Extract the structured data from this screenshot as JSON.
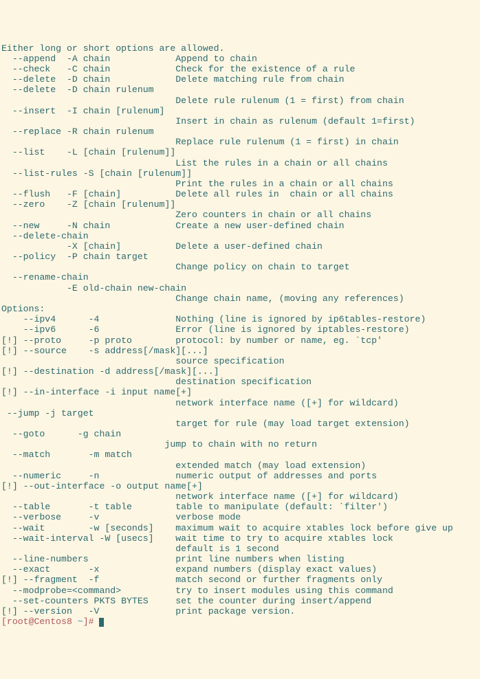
{
  "header": "Either long or short options are allowed.",
  "commands": [
    {
      "long": "  --append  -A chain",
      "desc": "            Append to chain"
    },
    {
      "long": "  --check   -C chain",
      "desc": "            Check for the existence of a rule"
    },
    {
      "long": "  --delete  -D chain",
      "desc": "            Delete matching rule from chain"
    },
    {
      "long": "  --delete  -D chain rulenum",
      "desc": ""
    },
    {
      "long": "",
      "desc": "                                Delete rule rulenum (1 = first) from chain"
    },
    {
      "long": "  --insert  -I chain [rulenum]",
      "desc": ""
    },
    {
      "long": "",
      "desc": "                                Insert in chain as rulenum (default 1=first)"
    },
    {
      "long": "  --replace -R chain rulenum",
      "desc": ""
    },
    {
      "long": "",
      "desc": "                                Replace rule rulenum (1 = first) in chain"
    },
    {
      "long": "  --list    -L [chain [rulenum]]",
      "desc": ""
    },
    {
      "long": "",
      "desc": "                                List the rules in a chain or all chains"
    },
    {
      "long": "  --list-rules -S [chain [rulenum]]",
      "desc": ""
    },
    {
      "long": "",
      "desc": "                                Print the rules in a chain or all chains"
    },
    {
      "long": "  --flush   -F [chain]",
      "desc": "          Delete all rules in  chain or all chains"
    },
    {
      "long": "  --zero    -Z [chain [rulenum]]",
      "desc": ""
    },
    {
      "long": "",
      "desc": "                                Zero counters in chain or all chains"
    },
    {
      "long": "  --new     -N chain",
      "desc": "            Create a new user-defined chain"
    },
    {
      "long": "  --delete-chain",
      "desc": ""
    },
    {
      "long": "            -X [chain]",
      "desc": "          Delete a user-defined chain"
    },
    {
      "long": "  --policy  -P chain target",
      "desc": ""
    },
    {
      "long": "",
      "desc": "                                Change policy on chain to target"
    },
    {
      "long": "  --rename-chain",
      "desc": ""
    },
    {
      "long": "            -E old-chain new-chain",
      "desc": ""
    },
    {
      "long": "",
      "desc": "                                Change chain name, (moving any references)"
    }
  ],
  "options_header": "Options:",
  "options": [
    {
      "o": "    --ipv4      -4",
      "d": "              Nothing (line is ignored by ip6tables-restore)"
    },
    {
      "o": "    --ipv6      -6",
      "d": "              Error (line is ignored by iptables-restore)"
    },
    {
      "o": "[!] --proto     -p proto",
      "d": "        protocol: by number or name, eg. `tcp'"
    },
    {
      "o": "[!] --source    -s address[/mask][...]",
      "d": ""
    },
    {
      "o": "",
      "d": "                                source specification"
    },
    {
      "o": "[!] --destination -d address[/mask][...]",
      "d": ""
    },
    {
      "o": "",
      "d": "                                destination specification"
    },
    {
      "o": "[!] --in-interface -i input name[+]",
      "d": ""
    },
    {
      "o": "",
      "d": "                                network interface name ([+] for wildcard)"
    },
    {
      "o": " --jump -j target",
      "d": ""
    },
    {
      "o": "",
      "d": "                                target for rule (may load target extension)"
    },
    {
      "o": "  --goto      -g chain",
      "d": ""
    },
    {
      "o": "",
      "d": "                              jump to chain with no return"
    },
    {
      "o": "  --match       -m match",
      "d": ""
    },
    {
      "o": "",
      "d": "                                extended match (may load extension)"
    },
    {
      "o": "  --numeric     -n",
      "d": "              numeric output of addresses and ports"
    },
    {
      "o": "[!] --out-interface -o output name[+]",
      "d": ""
    },
    {
      "o": "",
      "d": "                                network interface name ([+] for wildcard)"
    },
    {
      "o": "  --table       -t table",
      "d": "        table to manipulate (default: `filter')"
    },
    {
      "o": "  --verbose     -v",
      "d": "              verbose mode"
    },
    {
      "o": "  --wait        -w [seconds]",
      "d": "    maximum wait to acquire xtables lock before give up"
    },
    {
      "o": "  --wait-interval -W [usecs]",
      "d": "    wait time to try to acquire xtables lock"
    },
    {
      "o": "",
      "d": "                                default is 1 second"
    },
    {
      "o": "  --line-numbers",
      "d": "                print line numbers when listing"
    },
    {
      "o": "  --exact       -x",
      "d": "              expand numbers (display exact values)"
    },
    {
      "o": "[!] --fragment  -f",
      "d": "              match second or further fragments only"
    },
    {
      "o": "  --modprobe=<command>",
      "d": "          try to insert modules using this command"
    },
    {
      "o": "  --set-counters PKTS BYTES",
      "d": "     set the counter during insert/append"
    },
    {
      "o": "[!] --version   -V",
      "d": "              print package version."
    }
  ],
  "prompt": {
    "host": "[root@Centos8 ",
    "tilde": "~",
    "hash": "]# "
  }
}
